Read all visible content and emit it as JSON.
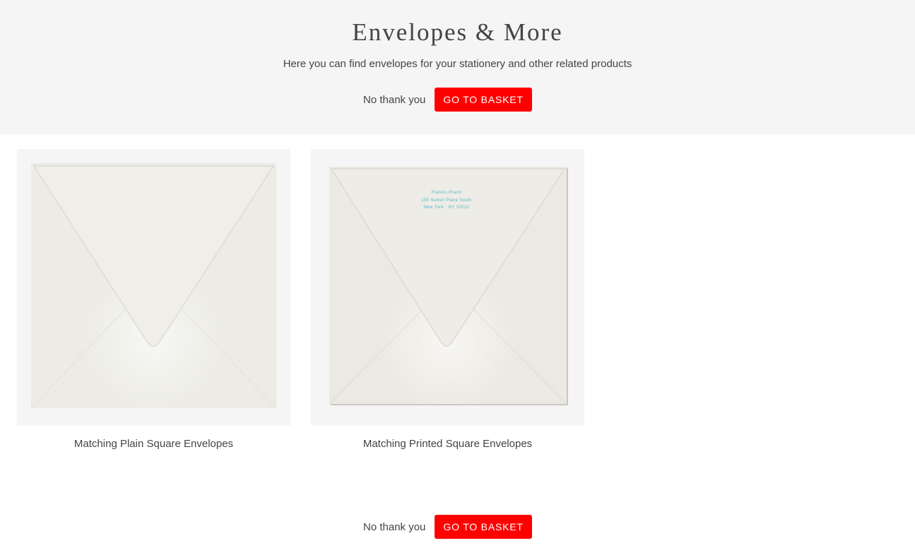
{
  "header": {
    "title": "Envelopes & More",
    "subtitle": "Here you can find envelopes for your stationery and other related products"
  },
  "actions": {
    "no_thanks_label": "No thank you",
    "basket_label": "GO TO BASKET"
  },
  "products": [
    {
      "name": "Matching Plain Square Envelopes"
    },
    {
      "name": "Matching Printed Square Envelopes",
      "printed_address": [
        "Francis Prantl",
        "100 Sutton Place South",
        "New York · NY 10022"
      ]
    }
  ],
  "colors": {
    "accent": "#ff0000",
    "hero_background": "#f5f5f5",
    "envelope": "#ecebe4",
    "address_ink": "#4fb8c4"
  }
}
